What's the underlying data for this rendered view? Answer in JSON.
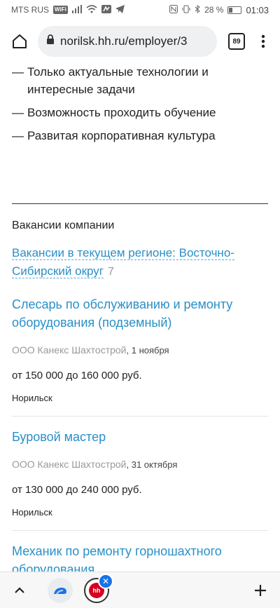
{
  "status_bar": {
    "carrier": "MTS RUS",
    "wifi_badge": "WiFi",
    "battery_text": "28 %",
    "time": "01:03"
  },
  "toolbar": {
    "url": "norilsk.hh.ru/employer/3",
    "tab_count": "89"
  },
  "benefits": [
    {
      "dash": "—",
      "text": "Только актуальные технологии и интересные задачи"
    },
    {
      "dash": "—",
      "text": "Возможность проходить обучение"
    },
    {
      "dash": "—",
      "text": "Развитая корпоративная культура"
    }
  ],
  "vacancies_section": {
    "title": "Вакансии компании",
    "region_link": "Вакансии в текущем регионе: Восточно-Сибирский округ",
    "region_count": "7"
  },
  "vacancies": [
    {
      "title": "Слесарь по обслуживанию и ремонту оборудования (подземный)",
      "company": "ООО Канекс Шахтострой",
      "date": ", 1 ноября",
      "salary": "от 150 000 до 160 000 руб.",
      "city": "Норильск"
    },
    {
      "title": "Буровой мастер",
      "company": "ООО Канекс Шахтострой",
      "date": ", 31 октября",
      "salary": "от 130 000 до 240 000 руб.",
      "city": "Норильск"
    },
    {
      "title": "Механик по ремонту горношахтного оборудования",
      "company": "",
      "date": "",
      "salary": "",
      "city": ""
    }
  ],
  "bottom_bar": {
    "hh_logo_text": "hh",
    "close_badge": "✕"
  },
  "colors": {
    "link": "#2a8fc7",
    "hh_brand": "#d6001c",
    "close_badge": "#1a73e8"
  }
}
